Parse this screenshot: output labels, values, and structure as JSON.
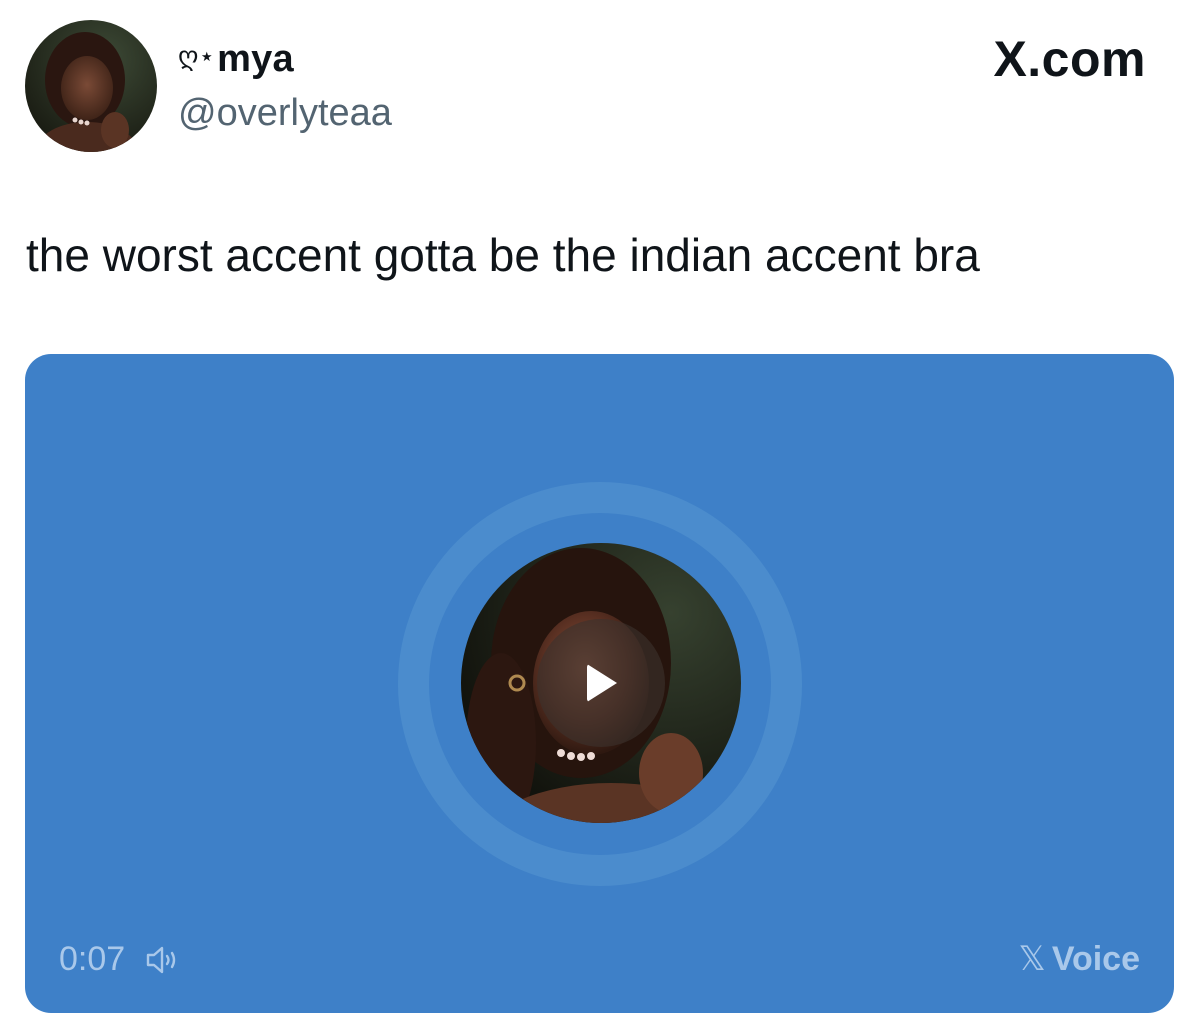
{
  "brand": {
    "label": "X.com"
  },
  "author": {
    "name_decoration": "ღ⋆",
    "display_name": "mya",
    "handle": "@overlyteaa"
  },
  "tweet": {
    "text": "the worst accent gotta be the indian accent bra"
  },
  "voice": {
    "duration": "0:07",
    "label_mark": "𝕏",
    "label_text": "Voice",
    "background_color": "#3e80c8",
    "ring_color": "#4b8ccd",
    "muted_text_color": "#a9c8ea"
  },
  "icons": {
    "play": "play-icon",
    "volume": "volume-icon",
    "avatar": "profile-photo"
  }
}
